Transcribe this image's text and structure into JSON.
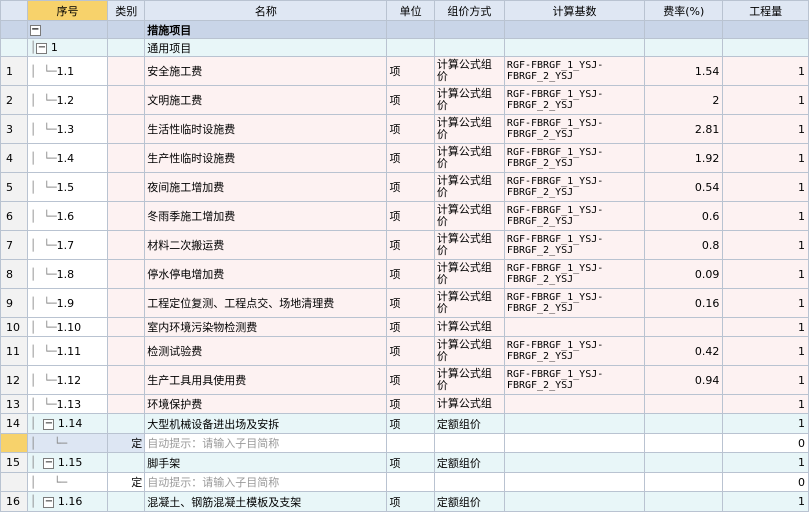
{
  "headers": {
    "rownum": "",
    "seq": "序号",
    "type": "类别",
    "name": "名称",
    "unit": "单位",
    "method": "组价方式",
    "base": "计算基数",
    "rate": "费率(%)",
    "qty": "工程量"
  },
  "root": {
    "name": "措施项目"
  },
  "group": {
    "seq": "1",
    "name": "通用项目"
  },
  "rows": [
    {
      "rownum": "1",
      "seq": "1.1",
      "name": "安全施工费",
      "unit": "项",
      "method": "计算公式组价",
      "base": "RGF-FBRGF_1_YSJ-FBRGF_2_YSJ",
      "rate": "1.54",
      "qty": "1"
    },
    {
      "rownum": "2",
      "seq": "1.2",
      "name": "文明施工费",
      "unit": "项",
      "method": "计算公式组价",
      "base": "RGF-FBRGF_1_YSJ-FBRGF_2_YSJ",
      "rate": "2",
      "qty": "1"
    },
    {
      "rownum": "3",
      "seq": "1.3",
      "name": "生活性临时设施费",
      "unit": "项",
      "method": "计算公式组价",
      "base": "RGF-FBRGF_1_YSJ-FBRGF_2_YSJ",
      "rate": "2.81",
      "qty": "1"
    },
    {
      "rownum": "4",
      "seq": "1.4",
      "name": "生产性临时设施费",
      "unit": "项",
      "method": "计算公式组价",
      "base": "RGF-FBRGF_1_YSJ-FBRGF_2_YSJ",
      "rate": "1.92",
      "qty": "1"
    },
    {
      "rownum": "5",
      "seq": "1.5",
      "name": "夜间施工增加费",
      "unit": "项",
      "method": "计算公式组价",
      "base": "RGF-FBRGF_1_YSJ-FBRGF_2_YSJ",
      "rate": "0.54",
      "qty": "1"
    },
    {
      "rownum": "6",
      "seq": "1.6",
      "name": "冬雨季施工增加费",
      "unit": "项",
      "method": "计算公式组价",
      "base": "RGF-FBRGF_1_YSJ-FBRGF_2_YSJ",
      "rate": "0.6",
      "qty": "1"
    },
    {
      "rownum": "7",
      "seq": "1.7",
      "name": "材料二次搬运费",
      "unit": "项",
      "method": "计算公式组价",
      "base": "RGF-FBRGF_1_YSJ-FBRGF_2_YSJ",
      "rate": "0.8",
      "qty": "1"
    },
    {
      "rownum": "8",
      "seq": "1.8",
      "name": "停水停电增加费",
      "unit": "项",
      "method": "计算公式组价",
      "base": "RGF-FBRGF_1_YSJ-FBRGF_2_YSJ",
      "rate": "0.09",
      "qty": "1"
    },
    {
      "rownum": "9",
      "seq": "1.9",
      "name": "工程定位复测、工程点交、场地清理费",
      "unit": "项",
      "method": "计算公式组价",
      "base": "RGF-FBRGF_1_YSJ-FBRGF_2_YSJ",
      "rate": "0.16",
      "qty": "1"
    },
    {
      "rownum": "10",
      "seq": "1.10",
      "name": "室内环境污染物检测费",
      "unit": "项",
      "method": "计算公式组",
      "base": "",
      "rate": "",
      "qty": "1"
    },
    {
      "rownum": "11",
      "seq": "1.11",
      "name": "检测试验费",
      "unit": "项",
      "method": "计算公式组价",
      "base": "RGF-FBRGF_1_YSJ-FBRGF_2_YSJ",
      "rate": "0.42",
      "qty": "1"
    },
    {
      "rownum": "12",
      "seq": "1.12",
      "name": "生产工具用具使用费",
      "unit": "项",
      "method": "计算公式组价",
      "base": "RGF-FBRGF_1_YSJ-FBRGF_2_YSJ",
      "rate": "0.94",
      "qty": "1"
    },
    {
      "rownum": "13",
      "seq": "1.13",
      "name": "环境保护费",
      "unit": "项",
      "method": "计算公式组",
      "base": "",
      "rate": "",
      "qty": "1"
    }
  ],
  "r14": {
    "rownum": "14",
    "seq": "1.14",
    "name": "大型机械设备进出场及安拆",
    "unit": "项",
    "method": "定额组价",
    "qty": "1"
  },
  "r14sub": {
    "type": "定",
    "name": "自动提示：请输入子目简称",
    "qty": "0"
  },
  "r15": {
    "rownum": "15",
    "seq": "1.15",
    "name": "脚手架",
    "unit": "项",
    "method": "定额组价",
    "qty": "1"
  },
  "r15sub": {
    "type": "定",
    "name": "自动提示：请输入子目简称",
    "qty": "0"
  },
  "r16": {
    "rownum": "16",
    "seq": "1.16",
    "name": "混凝土、钢筋混凝土模板及支架",
    "unit": "项",
    "method": "定额组价",
    "qty": "1"
  },
  "icons": {
    "collapse": "−"
  }
}
